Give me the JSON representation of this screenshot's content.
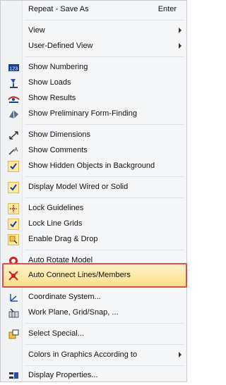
{
  "menu": {
    "items": [
      {
        "label": "Repeat - Save As",
        "shortcut": "Enter",
        "icon": ""
      },
      {
        "label": "View",
        "submenu": true,
        "icon": ""
      },
      {
        "label": "User-Defined View",
        "submenu": true,
        "icon": ""
      },
      {
        "label": "Show Numbering",
        "icon": "numbering-icon"
      },
      {
        "label": "Show Loads",
        "icon": "loads-icon"
      },
      {
        "label": "Show Results",
        "icon": "results-icon"
      },
      {
        "label": "Show Preliminary Form-Finding",
        "icon": "form-finding-icon"
      },
      {
        "label": "Show Dimensions",
        "icon": "dimensions-icon"
      },
      {
        "label": "Show Comments",
        "icon": "comments-icon"
      },
      {
        "label": "Show Hidden Objects in Background",
        "checked": true
      },
      {
        "label": "Display Model Wired or Solid",
        "checked": true
      },
      {
        "label": "Lock Guidelines",
        "icon": "lock-guidelines-icon"
      },
      {
        "label": "Lock Line Grids",
        "checked": true
      },
      {
        "label": "Enable Drag & Drop",
        "icon": "drag-drop-icon"
      },
      {
        "label": "Auto Rotate Model",
        "icon": "rotate-model-icon"
      },
      {
        "label": "Auto Connect Lines/Members",
        "icon": "auto-connect-icon",
        "highlighted": true
      },
      {
        "label": "Coordinate System...",
        "icon": "coordinate-system-icon"
      },
      {
        "label": "Work Plane, Grid/Snap, ...",
        "icon": "work-plane-icon"
      },
      {
        "label": "Select Special...",
        "icon": "select-special-icon"
      },
      {
        "label": "Colors in Graphics According to",
        "submenu": true,
        "icon": ""
      },
      {
        "label": "Display Properties...",
        "icon": "display-properties-icon"
      }
    ]
  },
  "colors": {
    "highlight_border": "#e44b4b",
    "highlight_fill": "#fbe08a"
  }
}
